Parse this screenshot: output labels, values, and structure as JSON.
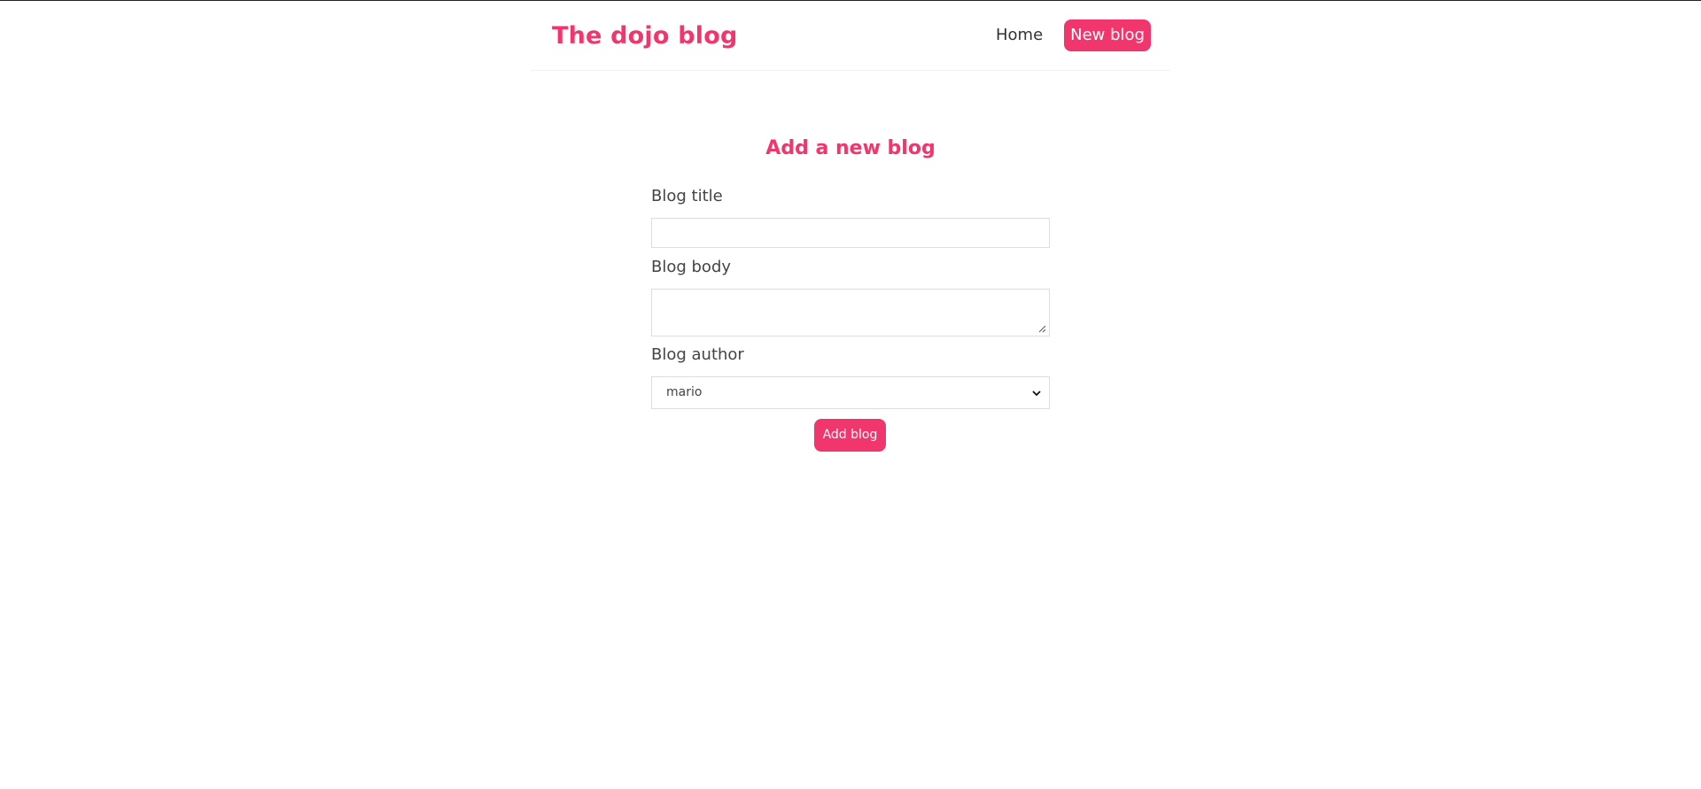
{
  "colors": {
    "accent": "#f1356d",
    "text": "#333333",
    "border": "#dddddd"
  },
  "navbar": {
    "brand": "The dojo blog",
    "links": [
      {
        "label": "Home"
      },
      {
        "label": "New blog"
      }
    ]
  },
  "create": {
    "heading": "Add a new blog",
    "title_label": "Blog title",
    "title_value": "",
    "body_label": "Blog body",
    "body_value": "",
    "author_label": "Blog author",
    "author_selected": "mario",
    "submit_label": "Add blog",
    "icons": {
      "select": "chevron-down-icon",
      "textarea": "resize-grip-icon"
    }
  }
}
